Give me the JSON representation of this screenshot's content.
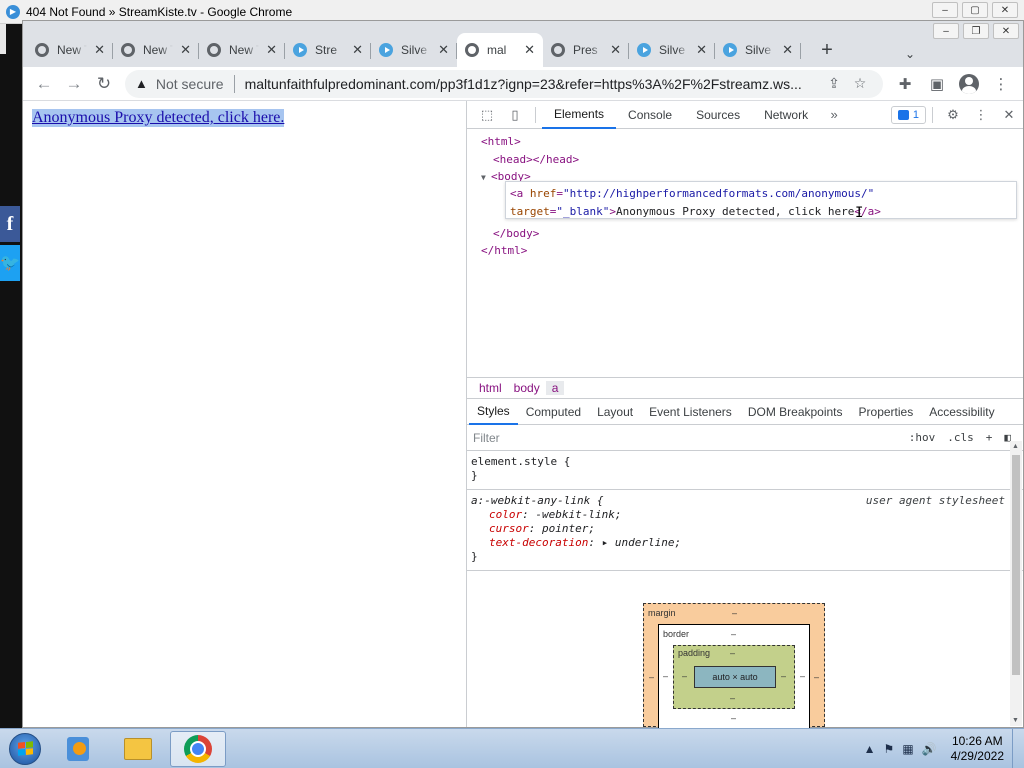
{
  "window": {
    "title": "404 Not Found » StreamKiste.tv - Google Chrome",
    "controls": [
      "–",
      "▢",
      "✕"
    ]
  },
  "tabs": [
    {
      "label": "New Tab",
      "icon": "globe-icon",
      "active": false
    },
    {
      "label": "New Tab",
      "icon": "globe-icon",
      "active": false
    },
    {
      "label": "New Tab",
      "icon": "globe-icon",
      "active": false
    },
    {
      "label": "Stre",
      "icon": "play-icon",
      "active": false
    },
    {
      "label": "Silve",
      "icon": "play-icon",
      "active": false
    },
    {
      "label": "mal",
      "icon": "globe-icon",
      "active": true
    },
    {
      "label": "Pres",
      "icon": "globe-icon",
      "active": false
    },
    {
      "label": "Silve",
      "icon": "play-icon",
      "active": false
    },
    {
      "label": "Silve",
      "icon": "play-icon",
      "active": false
    }
  ],
  "toolbar": {
    "security_label": "Not secure",
    "url": "maltunfaithfulpredominant.com/pp3f1d1z?ignp=23&refer=https%3A%2F%2Fstreamz.ws..."
  },
  "page": {
    "link_text": "Anonymous Proxy detected, click here."
  },
  "devtools": {
    "main_tabs": [
      "Elements",
      "Console",
      "Sources",
      "Network"
    ],
    "issues_count": "1",
    "dom": {
      "html_open": "<html>",
      "head": "<head></head>",
      "body_open": "<body>",
      "a_open": "<a ",
      "a_href_attr": "href",
      "a_href_val": "\"http://highperformancedformats.com/anonymous/\"",
      "a_target_attr": "target",
      "a_target_val": "\"_blank\"",
      "a_text": "Anonymous Proxy detected, click here",
      "a_close": "</a>",
      "body_close": "</body>",
      "html_close": "</html>"
    },
    "breadcrumbs": [
      "html",
      "body",
      "a"
    ],
    "sub_tabs": [
      "Styles",
      "Computed",
      "Layout",
      "Event Listeners",
      "DOM Breakpoints",
      "Properties",
      "Accessibility"
    ],
    "filter_placeholder": "Filter",
    "filter_hov": ":hov",
    "filter_cls": ".cls",
    "element_style": "element.style {",
    "rule_selector": "a:-webkit-any-link {",
    "rule_source": "user agent stylesheet",
    "declarations": [
      {
        "prop": "color",
        "value": "-webkit-link;"
      },
      {
        "prop": "cursor",
        "value": "pointer;"
      },
      {
        "prop": "text-decoration",
        "value": "▸ underline;"
      }
    ],
    "box_model": {
      "margin": "margin",
      "border": "border",
      "padding": "padding",
      "content": "auto × auto",
      "dash": "–"
    }
  },
  "taskbar": {
    "time": "10:26 AM",
    "date": "4/29/2022"
  }
}
